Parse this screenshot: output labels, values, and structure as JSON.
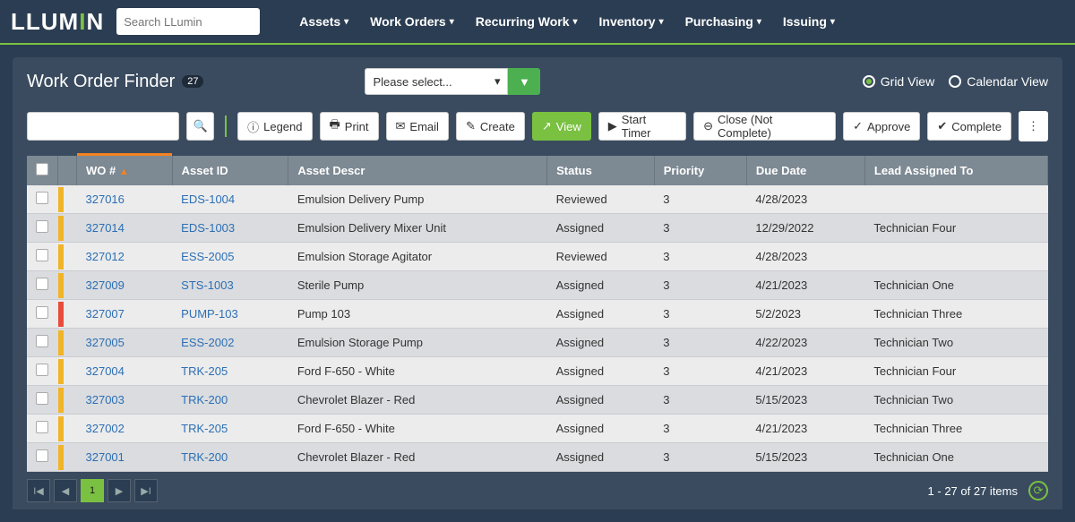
{
  "brand": "LLUMIN",
  "search": {
    "placeholder": "Search LLumin"
  },
  "nav": [
    "Assets",
    "Work Orders",
    "Recurring Work",
    "Inventory",
    "Purchasing",
    "Issuing"
  ],
  "panel": {
    "title": "Work Order Finder",
    "count": "27",
    "select_placeholder": "Please select...",
    "view_grid": "Grid View",
    "view_calendar": "Calendar View"
  },
  "toolbar": {
    "legend": "Legend",
    "print": "Print",
    "email": "Email",
    "create": "Create",
    "view": "View",
    "start_timer": "Start Timer",
    "close": "Close (Not Complete)",
    "approve": "Approve",
    "complete": "Complete"
  },
  "columns": {
    "wo": "WO #",
    "asset_id": "Asset ID",
    "asset_descr": "Asset Descr",
    "status": "Status",
    "priority": "Priority",
    "due_date": "Due Date",
    "lead": "Lead Assigned To"
  },
  "rows": [
    {
      "stripe": "gold",
      "wo": "327016",
      "asset_id": "EDS-1004",
      "asset_descr": "Emulsion Delivery Pump",
      "status": "Reviewed",
      "priority": "3",
      "due": "4/28/2023",
      "lead": ""
    },
    {
      "stripe": "gold",
      "wo": "327014",
      "asset_id": "EDS-1003",
      "asset_descr": "Emulsion Delivery Mixer Unit",
      "status": "Assigned",
      "priority": "3",
      "due": "12/29/2022",
      "lead": "Technician Four"
    },
    {
      "stripe": "gold",
      "wo": "327012",
      "asset_id": "ESS-2005",
      "asset_descr": "Emulsion Storage Agitator",
      "status": "Reviewed",
      "priority": "3",
      "due": "4/28/2023",
      "lead": ""
    },
    {
      "stripe": "gold",
      "wo": "327009",
      "asset_id": "STS-1003",
      "asset_descr": "Sterile Pump",
      "status": "Assigned",
      "priority": "3",
      "due": "4/21/2023",
      "lead": "Technician One"
    },
    {
      "stripe": "red",
      "wo": "327007",
      "asset_id": "PUMP-103",
      "asset_descr": "Pump 103",
      "status": "Assigned",
      "priority": "3",
      "due": "5/2/2023",
      "lead": "Technician Three"
    },
    {
      "stripe": "gold",
      "wo": "327005",
      "asset_id": "ESS-2002",
      "asset_descr": "Emulsion Storage Pump",
      "status": "Assigned",
      "priority": "3",
      "due": "4/22/2023",
      "lead": "Technician Two"
    },
    {
      "stripe": "gold",
      "wo": "327004",
      "asset_id": "TRK-205",
      "asset_descr": "Ford F-650 - White",
      "status": "Assigned",
      "priority": "3",
      "due": "4/21/2023",
      "lead": "Technician Four"
    },
    {
      "stripe": "gold",
      "wo": "327003",
      "asset_id": "TRK-200",
      "asset_descr": "Chevrolet Blazer - Red",
      "status": "Assigned",
      "priority": "3",
      "due": "5/15/2023",
      "lead": "Technician Two"
    },
    {
      "stripe": "gold",
      "wo": "327002",
      "asset_id": "TRK-205",
      "asset_descr": "Ford F-650 - White",
      "status": "Assigned",
      "priority": "3",
      "due": "4/21/2023",
      "lead": "Technician Three"
    },
    {
      "stripe": "gold",
      "wo": "327001",
      "asset_id": "TRK-200",
      "asset_descr": "Chevrolet Blazer - Red",
      "status": "Assigned",
      "priority": "3",
      "due": "5/15/2023",
      "lead": "Technician One"
    }
  ],
  "footer": {
    "page": "1",
    "summary": "1 - 27 of 27 items"
  }
}
